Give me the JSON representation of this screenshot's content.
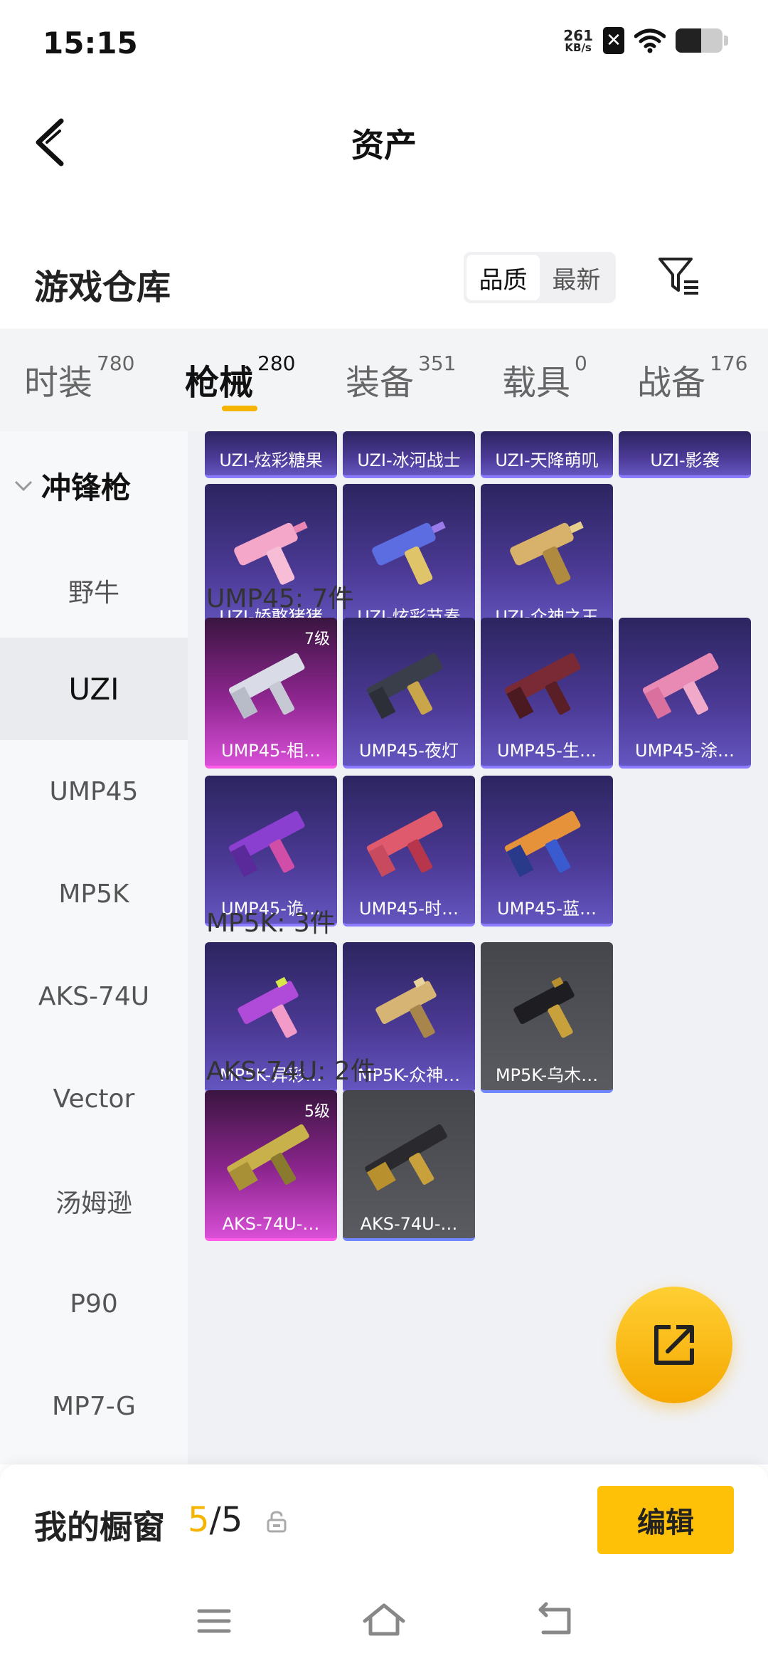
{
  "status": {
    "time": "15:15",
    "net_speed_value": "261",
    "net_speed_unit": "KB/s",
    "battery_level": 0.55
  },
  "header": {
    "title": "资产"
  },
  "warehouse": {
    "title": "游戏仓库",
    "sort_quality": "品质",
    "sort_newest": "最新"
  },
  "tabs": [
    {
      "label": "时装",
      "count": "780"
    },
    {
      "label": "枪械",
      "count": "280"
    },
    {
      "label": "装备",
      "count": "351"
    },
    {
      "label": "载具",
      "count": "0"
    },
    {
      "label": "战备",
      "count": "176"
    }
  ],
  "sidebar": {
    "category": "冲锋枪",
    "items": [
      "野牛",
      "UZI",
      "UMP45",
      "MP5K",
      "AKS-74U",
      "Vector",
      "汤姆逊",
      "P90",
      "MP7-G"
    ]
  },
  "uzi_top": [
    "UZI-炫彩糖果",
    "UZI-冰河战士",
    "UZI-天降萌叽",
    "UZI-影袭"
  ],
  "uzi_row2": [
    "UZI-娇憨猪猪",
    "UZI-炫彩节奏",
    "UZI-众神之王"
  ],
  "ump": {
    "label": "UMP45: 7件",
    "items": [
      {
        "name": "UMP45-相…",
        "level": "7级"
      },
      {
        "name": "UMP45-夜灯"
      },
      {
        "name": "UMP45-生…"
      },
      {
        "name": "UMP45-涂…"
      },
      {
        "name": "UMP45-诡…"
      },
      {
        "name": "UMP45-时…"
      },
      {
        "name": "UMP45-蓝…"
      }
    ]
  },
  "mp5k": {
    "label": "MP5K: 3件",
    "items": [
      "MP5K-异彩…",
      "MP5K-众神…",
      "MP5K-乌木…"
    ]
  },
  "aks": {
    "label": "AKS-74U: 2件",
    "items": [
      {
        "name": "AKS-74U-…",
        "level": "5级"
      },
      {
        "name": "AKS-74U-…"
      }
    ]
  },
  "window": {
    "title": "我的橱窗",
    "current": "5",
    "separator": "/",
    "total": "5",
    "edit_label": "编辑"
  },
  "colors": {
    "accent": "#f5b400",
    "edit_button": "#ffc107",
    "card_purple": "#4c3a96",
    "card_pink": "#8e2690",
    "card_gray": "#5a5b61"
  }
}
